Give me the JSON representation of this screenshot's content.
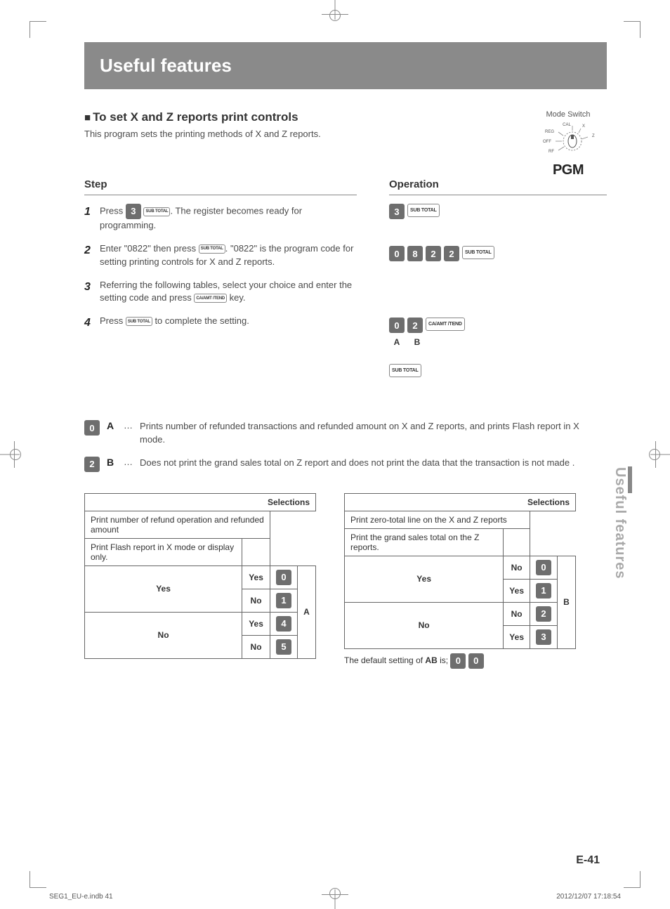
{
  "title": "Useful features",
  "section": {
    "heading": "To set X and Z reports print controls",
    "desc": "This program sets the printing methods of X and Z reports."
  },
  "mode_switch": {
    "label": "Mode Switch",
    "positions": {
      "cal": "CAL",
      "reg": "REG",
      "off": "OFF",
      "rf": "RF",
      "x": "X",
      "z": "Z"
    },
    "current": "PGM"
  },
  "headers": {
    "step": "Step",
    "operation": "Operation"
  },
  "steps": [
    {
      "num": "1",
      "pre": "Press ",
      "key1": "3",
      "keycap": "SUB TOTAL",
      "post": ". The register becomes ready for programming."
    },
    {
      "num": "2",
      "pre": "Enter \"0822\" then press ",
      "keycap": "SUB TOTAL",
      "post": ". \"0822\" is the program code for setting printing controls for X and Z reports."
    },
    {
      "num": "3",
      "pre": "Referring the following tables, select your choice and enter the setting code and press ",
      "keycap": "CA/AMT /TEND",
      "post": " key."
    },
    {
      "num": "4",
      "pre": "Press ",
      "keycap": "SUB TOTAL",
      "post": " to complete the setting."
    }
  ],
  "operation": {
    "row1": {
      "digits": [
        "3"
      ],
      "cap": "SUB TOTAL"
    },
    "row2": {
      "digits": [
        "0",
        "8",
        "2",
        "2"
      ],
      "cap": "SUB TOTAL"
    },
    "row3": {
      "digits": [
        "0",
        "2"
      ],
      "cap": "CA/AMT /TEND",
      "labels": {
        "a": "A",
        "b": "B"
      }
    },
    "row4": {
      "cap": "SUB TOTAL"
    }
  },
  "defs": [
    {
      "digit": "0",
      "letter": "A",
      "text": "Prints number of refunded transactions and refunded amount on X and Z reports, and prints Flash report in X mode."
    },
    {
      "digit": "2",
      "letter": "B",
      "text": "Does not print the grand sales total on Z report and does not print the data that the transaction is not made ."
    }
  ],
  "tableA": {
    "sel": "Selections",
    "row1": "Print number of refund operation and refunded amount",
    "row2": "Print Flash report in X mode or display only.",
    "side": "A",
    "cells": [
      {
        "g1": "Yes",
        "g2": "Yes",
        "code": "0"
      },
      {
        "g1": "Yes",
        "g2": "No",
        "code": "1"
      },
      {
        "g1": "No",
        "g2": "Yes",
        "code": "4"
      },
      {
        "g1": "No",
        "g2": "No",
        "code": "5"
      }
    ]
  },
  "tableB": {
    "sel": "Selections",
    "row1": "Print zero-total line on the X and Z reports",
    "row2": "Print the grand sales total on the Z reports.",
    "side": "B",
    "cells": [
      {
        "g1": "Yes",
        "g2": "No",
        "code": "0"
      },
      {
        "g1": "Yes",
        "g2": "Yes",
        "code": "1"
      },
      {
        "g1": "No",
        "g2": "No",
        "code": "2"
      },
      {
        "g1": "No",
        "g2": "Yes",
        "code": "3"
      }
    ]
  },
  "default_note": {
    "pre": "The default setting of ",
    "bold": "AB",
    "mid": " is; ",
    "d1": "0",
    "d2": "0"
  },
  "side_tab": "Useful features",
  "page_num": "E-41",
  "footer": {
    "left": "SEG1_EU-e.indb   41",
    "right": "2012/12/07   17:18:54"
  }
}
